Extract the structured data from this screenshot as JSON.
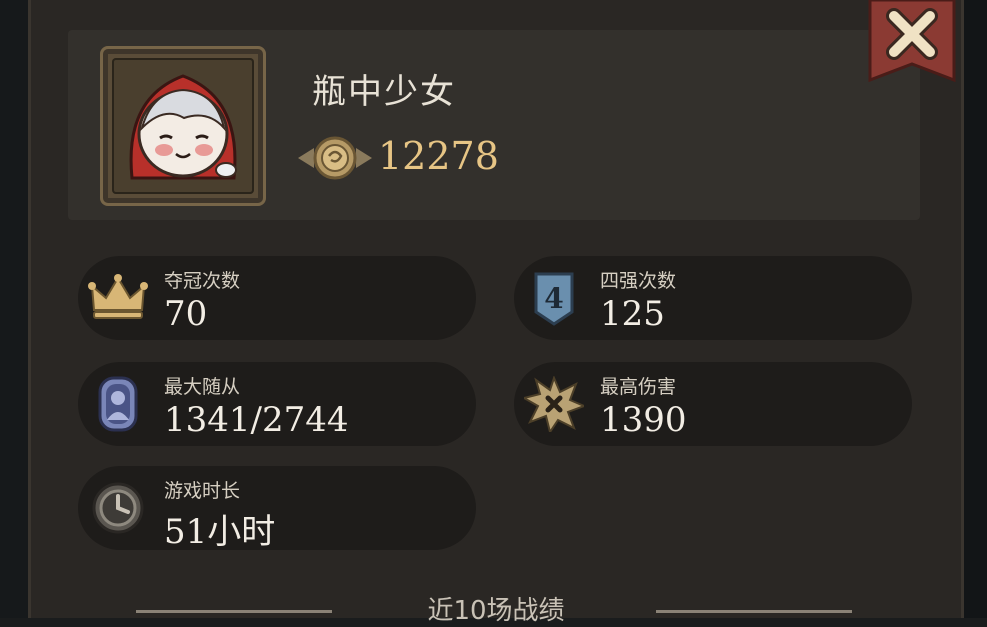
{
  "player": {
    "name": "瓶中少女",
    "coins": "12278"
  },
  "stats": [
    {
      "label": "夺冠次数",
      "value": "70",
      "icon": "crown-icon"
    },
    {
      "label": "四强次数",
      "value": "125",
      "icon": "shield-four-icon"
    },
    {
      "label": "最大随从",
      "value": "1341/2744",
      "icon": "minion-portrait-icon"
    },
    {
      "label": "最高伤害",
      "value": "1390",
      "icon": "damage-burst-icon"
    },
    {
      "label": "游戏时长",
      "value": "51小时",
      "icon": "clock-icon"
    }
  ],
  "recent": {
    "title": "近10场战绩"
  },
  "colors": {
    "panel": "#2a2724",
    "stat_bg": "#1e1c1a",
    "gold": "#e7c585",
    "close_banner": "#8b3a33"
  }
}
